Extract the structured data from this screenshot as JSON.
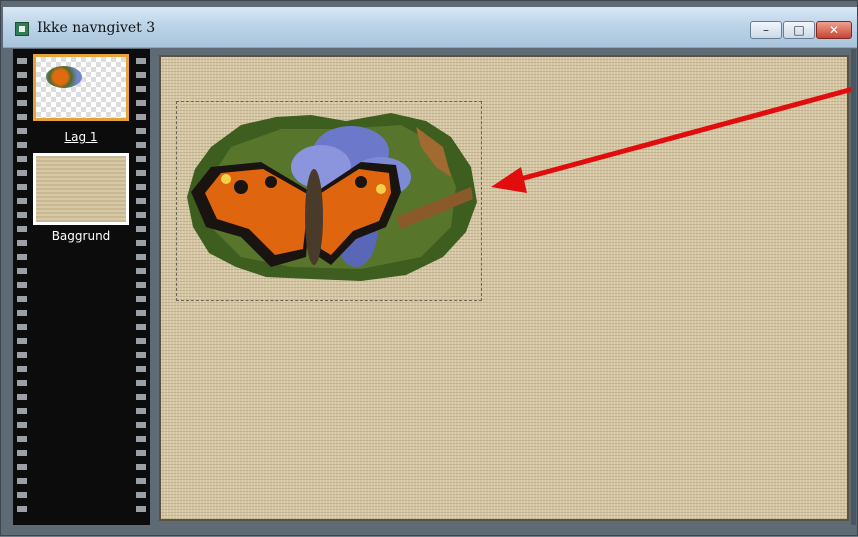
{
  "window": {
    "title": "Ikke navngivet 3",
    "controls": {
      "minimize": "–",
      "maximize": "□",
      "close": "✕"
    }
  },
  "layers": [
    {
      "label": "Lag 1",
      "selected": true
    },
    {
      "label": "Baggrund",
      "selected": false
    }
  ],
  "colors": {
    "selected_layer_border": "#e7a33b",
    "arrow": "#e10d0d",
    "canvas_texture": "#d4c5a3"
  },
  "icons": {
    "app": "app-document-icon"
  }
}
